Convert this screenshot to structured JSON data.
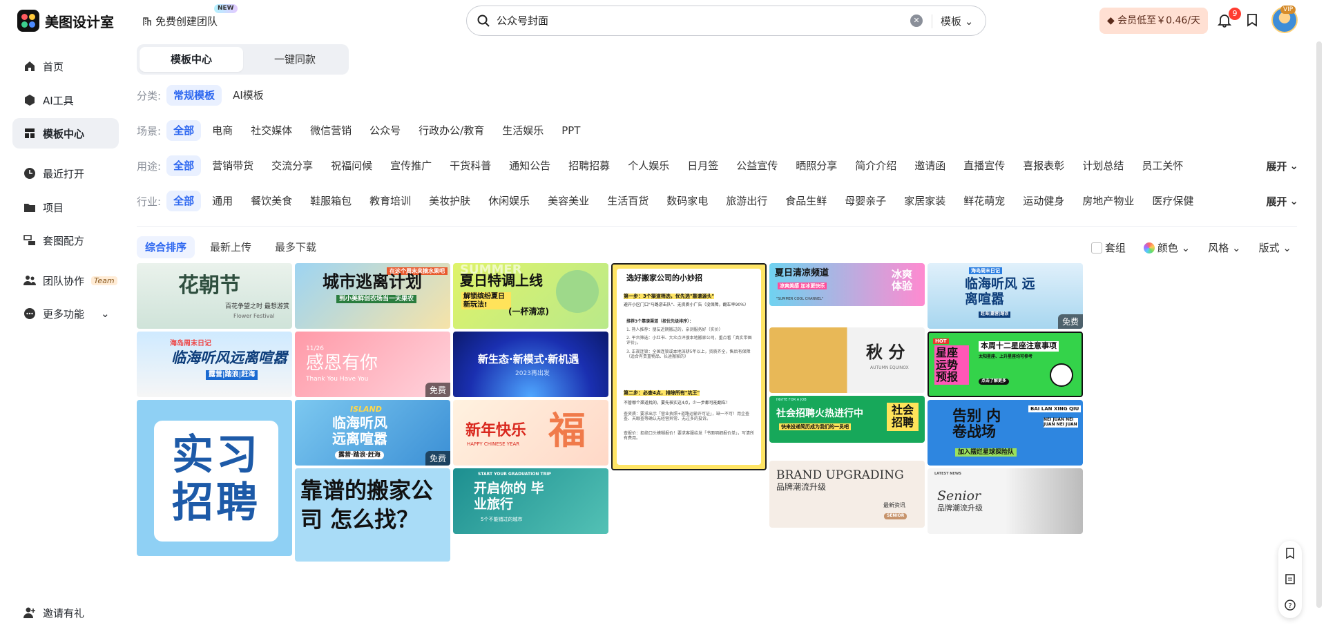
{
  "app": {
    "name": "美图设计室",
    "team_create": "免费创建团队",
    "new_badge": "NEW"
  },
  "search": {
    "value": "公众号封面",
    "type": "模板"
  },
  "header": {
    "vip_cta": "会员低至￥0.46/天",
    "notif_count": "9",
    "vip_tag": "VIP"
  },
  "sidebar": {
    "items": [
      {
        "label": "首页"
      },
      {
        "label": "AI工具"
      },
      {
        "label": "模板中心"
      },
      {
        "label": "最近打开"
      },
      {
        "label": "项目"
      },
      {
        "label": "套图配方"
      },
      {
        "label": "团队协作",
        "tag": "Team"
      },
      {
        "label": "更多功能"
      }
    ],
    "invite": "邀请有礼"
  },
  "tabs": {
    "a": "模板中心",
    "b": "一键同款"
  },
  "filters": {
    "category": {
      "label": "分类:",
      "items": [
        "常规模板",
        "AI模板"
      ]
    },
    "scene": {
      "label": "场景:",
      "items": [
        "全部",
        "电商",
        "社交媒体",
        "微信营销",
        "公众号",
        "行政办公/教育",
        "生活娱乐",
        "PPT"
      ]
    },
    "usage": {
      "label": "用途:",
      "items": [
        "全部",
        "营销带货",
        "交流分享",
        "祝福问候",
        "宣传推广",
        "干货科普",
        "通知公告",
        "招聘招募",
        "个人娱乐",
        "日月签",
        "公益宣传",
        "晒照分享",
        "简介介绍",
        "邀请函",
        "直播宣传",
        "喜报表彰",
        "计划总结",
        "员工关怀"
      ]
    },
    "industry": {
      "label": "行业:",
      "items": [
        "全部",
        "通用",
        "餐饮美食",
        "鞋服箱包",
        "教育培训",
        "美妆护肤",
        "休闲娱乐",
        "美容美业",
        "生活百货",
        "数码家电",
        "旅游出行",
        "食品生鲜",
        "母婴亲子",
        "家居家装",
        "鲜花萌宠",
        "运动健身",
        "房地产物业",
        "医疗保健"
      ]
    },
    "expand": "展开"
  },
  "sort": {
    "items": [
      "综合排序",
      "最新上传",
      "最多下载"
    ]
  },
  "tools": {
    "group": "套组",
    "color": "颜色",
    "style": "风格",
    "layout": "版式"
  },
  "cards": {
    "c1": {
      "title": "花朝节",
      "sub": "百花争望之时 最想游赏",
      "sub2": "Flower Festival"
    },
    "c2": {
      "title": "城市逃离计划",
      "sub": "到小美鲜创农场当一天果农",
      "ribbon": "在这个周末来摘水果吧"
    },
    "c3": {
      "title": "夏日特调上线",
      "sub": "解锁缤纷夏日 新玩法!",
      "sub2": "(一杯清凉)",
      "bg": "SUMMER"
    },
    "c4": {
      "title": "选好搬家公司的小妙招",
      "step1": "第一步：3个渠道筛选，优先选\"靠谱源头\"",
      "body1": "避开小区门口\"马路游击队\"、无资质小广告（没保障，翻车率90%）",
      "rec": "推荐3个靠谱渠道（按优先级排序）：",
      "r1": "1. 熟人推荐：朋友近期搬过的，亲测服务好（实价）",
      "r2": "2. 平台筛选：小红书、大众点评搜本地搬家公司，重点看「真实带图评价」。",
      "r3": "3. 正规连锁：全国连锁或本地深耕5年以上，资质齐全，售后有保障（适合有贵重物品、长途搬家的）",
      "step2": "第二步：必查4点，排除所有\"坑王\"",
      "body2": "不管哪个渠道找的，要先核实这4点，少一步都可能翻车！",
      "b3": "查资质：要求出示「营业执照+道路运输许可证」，缺一不可！用企查查、天眼查等确认无经营异常、无过多的投诉。",
      "b4": "查报价：拒绝口头模糊报价！要求客服给发「书面明细报价单」，写清所有费用。"
    },
    "c5": {
      "title": "夏日清凉频道",
      "sub": "凉爽美感 加冰更快乐",
      "right": "冰爽 体验",
      "foot": "\"SUMMER COOL CHANNEL\""
    },
    "c6": {
      "title": "临海听风 远离喧嚣",
      "top": "海岛周末日记",
      "sub": "赶海|露营|踏浪"
    },
    "c7": {
      "title": "临海听风远离喧嚣",
      "top": "海岛周末日记",
      "sub": "露营|踏浪|赶海"
    },
    "c8": {
      "title": "感恩有你",
      "sub": "Thank You Have You",
      "date": "11/26"
    },
    "c9": {
      "title": "新生态·新模式·新机遇",
      "sub": "2023再出发"
    },
    "c10": {
      "title": "秋 分",
      "sub": "AUTUMN EQUINOX"
    },
    "c11": {
      "title": "星座 运势 预报",
      "hot": "HOT",
      "right": "本周十二星座注意事项",
      "r2": "太阳星座、上升星座均可参考",
      "btn": "点击了解更多"
    },
    "c12": {
      "title": "实习 招聘"
    },
    "c13": {
      "title": "临海听风 远离喧嚣",
      "top": "ISLAND",
      "sub": "露营·踏浪·赶海"
    },
    "c14": {
      "title": "新年快乐",
      "sub": "HAPPY CHINESE YEAR",
      "deco": "福"
    },
    "c15": {
      "title": "社会招聘火热进行中",
      "sub": "快来投递简历成为我们的一员吧",
      "right": "社会 招聘",
      "top": "INVITE FOR A JOB"
    },
    "c16": {
      "title": "告别 内卷战场",
      "top": "BAI LAN XING QIU",
      "sub": "加入摆烂星球探险队",
      "side": "NEI JUAN NEI JUAN NEI JUAN"
    },
    "c17": {
      "title": "BRAND UPGRADING",
      "sub": "品牌潮流升级",
      "tag": "最新资讯",
      "tag2": "SENIOR"
    },
    "c18": {
      "title": "Senior",
      "sub": "品牌潮流升级",
      "top": "LATEST NEWS"
    },
    "c19": {
      "title": "靠谱的搬家公司 怎么找？"
    },
    "c20": {
      "title": "开启你的 毕业旅行",
      "top": "START YOUR GRADUATION TRIP",
      "sub": "5个不能错过的城市"
    },
    "free": "免费"
  }
}
